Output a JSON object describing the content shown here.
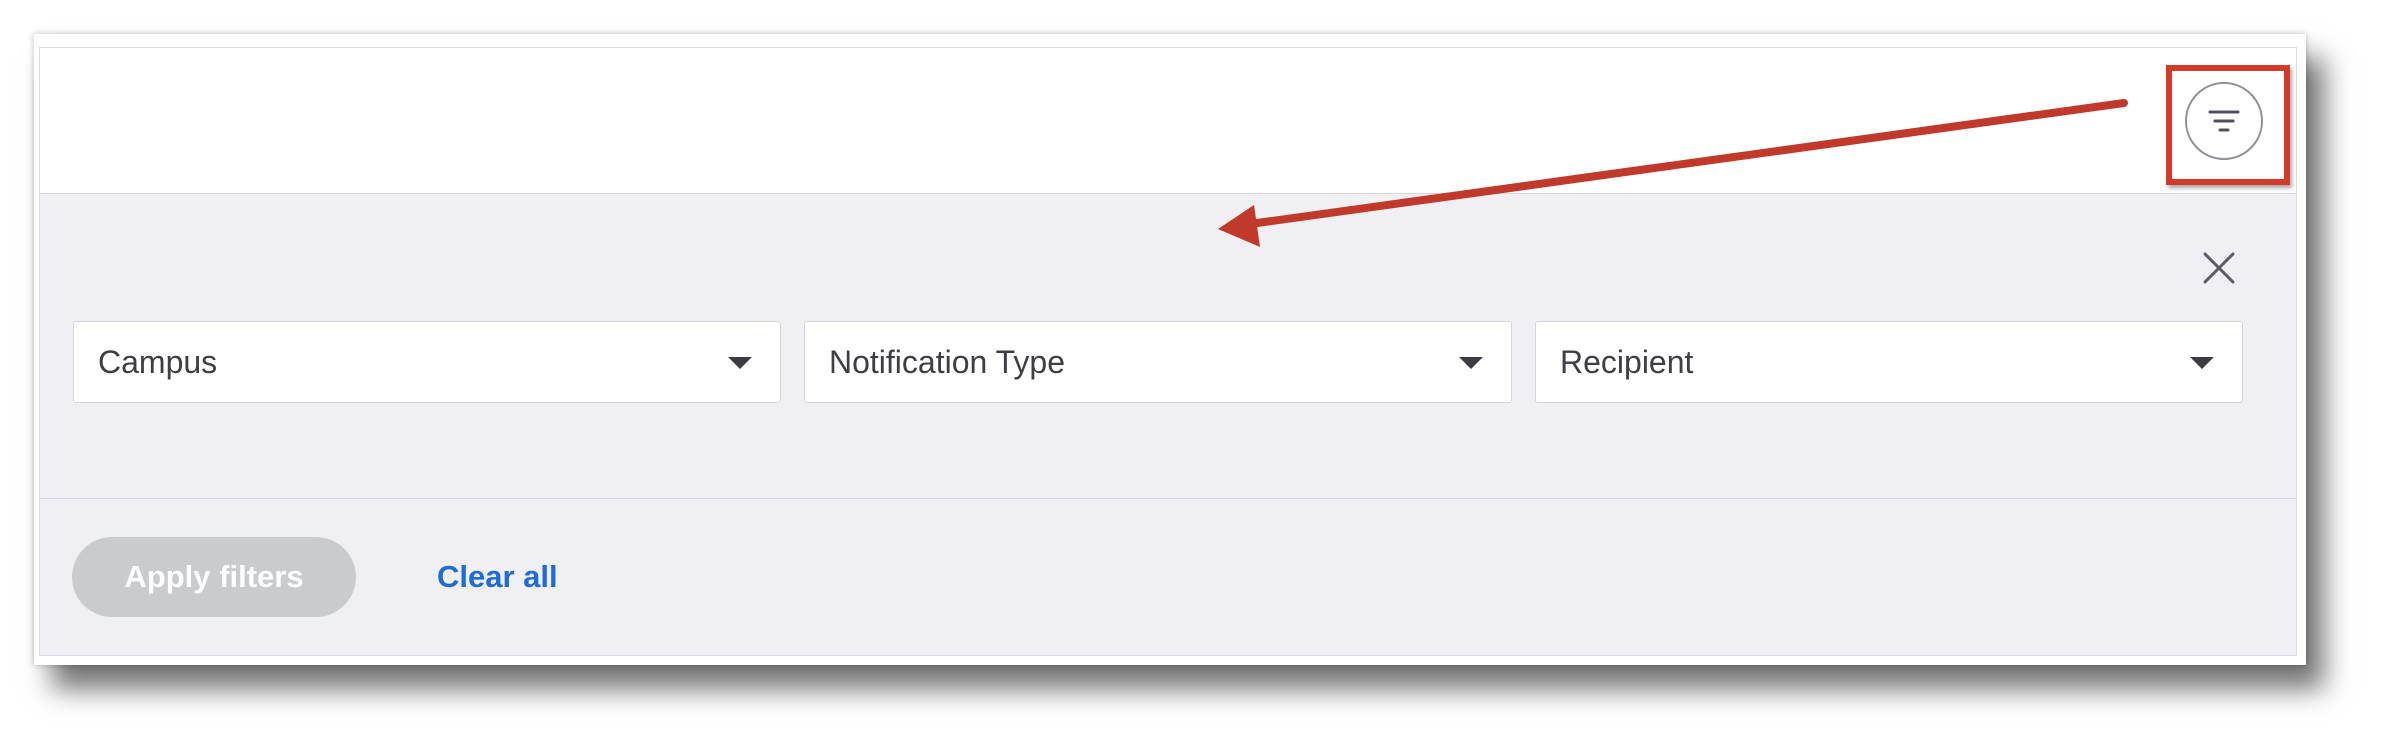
{
  "filter_toggle": {
    "icon": "filter-icon"
  },
  "close": {
    "icon": "close-icon"
  },
  "filters": [
    {
      "label": "Campus",
      "icon": "caret-down-icon"
    },
    {
      "label": "Notification Type",
      "icon": "caret-down-icon"
    },
    {
      "label": "Recipient",
      "icon": "caret-down-icon"
    }
  ],
  "actions": {
    "apply_label": "Apply filters",
    "clear_label": "Clear all"
  },
  "colors": {
    "annotation": "#d23a2a",
    "link": "#1f6bd8",
    "apply_disabled": "#c9cbcf",
    "panel_bg": "#f0f0f4"
  }
}
